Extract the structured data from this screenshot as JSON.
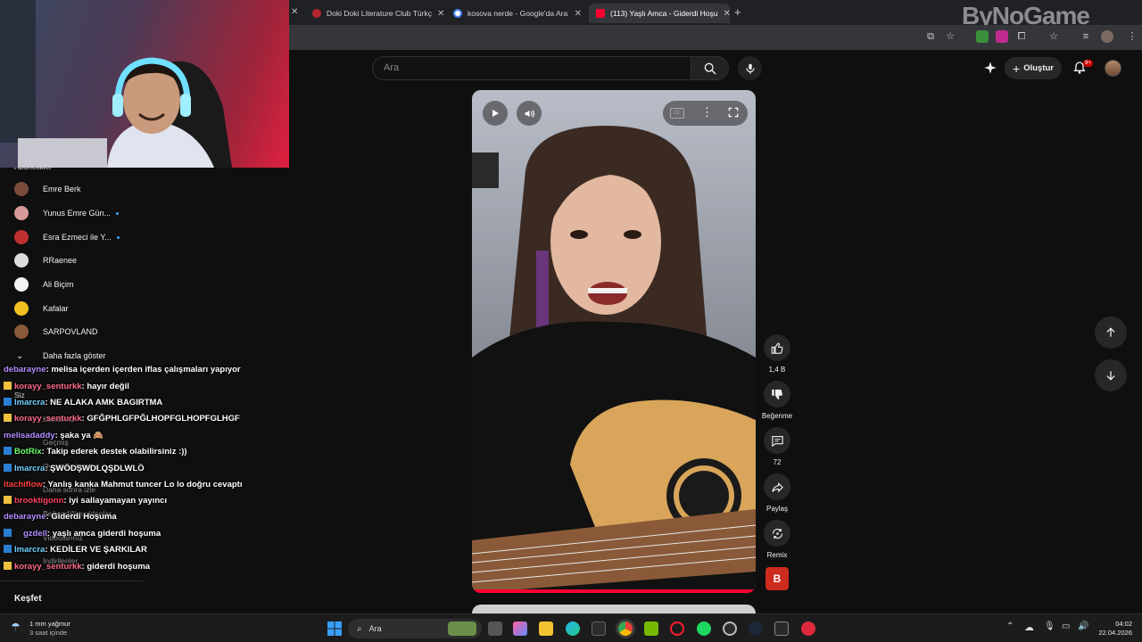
{
  "browser": {
    "tabs": [
      {
        "title": "Doki Doki Literature Club Türkç",
        "favicon_color": "#b3262e"
      },
      {
        "title": "kosova nerde - Google'da Ara",
        "favicon_color": "#ffffff"
      },
      {
        "title": "(113) Yaşlı Amca - Giderdi Hoşu",
        "favicon_color": "#ff0033"
      }
    ],
    "new_tab": "+"
  },
  "watermark": "ByNoGame",
  "youtube": {
    "search_placeholder": "Ara",
    "create_label": "Oluştur",
    "notification_count": "9+"
  },
  "sidebar": {
    "section_partial": "Abonelikler",
    "subscriptions": [
      {
        "name": "Emre Berk",
        "live": false,
        "avatar_color": "#7a4a3a"
      },
      {
        "name": "Yunus Emre Gün...",
        "live": true,
        "avatar_color": "#d79a9a"
      },
      {
        "name": "Esra Ezmeci ile Y...",
        "live": true,
        "avatar_color": "#c03030"
      },
      {
        "name": "RRaenee",
        "live": false,
        "avatar_color": "#dddddd"
      },
      {
        "name": "Ali Biçim",
        "live": false,
        "avatar_color": "#f2f2f2"
      },
      {
        "name": "Kafalar",
        "live": false,
        "avatar_color": "#f0c020"
      },
      {
        "name": "SARPOVLAND",
        "live": false,
        "avatar_color": "#8a5a3a"
      }
    ],
    "show_more": "Daha fazla göster",
    "you_section": "Siz",
    "you_items": [
      "Kanalınız",
      "Geçmiş",
      "Oynatma listeleri",
      "Daha sonra izle",
      "Beğendiğim videolar",
      "Videolarınız",
      "İndirilenler"
    ],
    "explore": "Keşfet"
  },
  "chat": [
    {
      "user": "debarayne",
      "color": "#b48cff",
      "msg": ": melisa içerden içerden iflas çalışmaları yapıyor",
      "badge": ""
    },
    {
      "user": "korayy_senturkk",
      "color": "#ff6b8a",
      "msg": ": hayır değil",
      "badge": "#f0c040"
    },
    {
      "user": "lmarcra",
      "color": "#6fd3ff",
      "msg": ": NE ALAKA AMK BAGIRTMA",
      "badge": "#2a7fd4"
    },
    {
      "user": "korayy_senturkk",
      "color": "#ff6b8a",
      "msg": ": GFĞPHLGFPĞLHOPFGLHOPFGLHGF",
      "badge": "#f0c040"
    },
    {
      "user": "melisadaddy",
      "color": "#b48cff",
      "msg": ": şaka ya 🙈",
      "badge": ""
    },
    {
      "user": "BotRix",
      "color": "#6bff6b",
      "msg": ": Takip ederek destek olabilirsiniz :))",
      "badge": "#2a7fd4"
    },
    {
      "user": "lmarcra",
      "color": "#6fd3ff",
      "msg": ": ŞWÖDŞWDLQŞDLWLÖ",
      "badge": "#2a7fd4"
    },
    {
      "user": "itachiflow",
      "color": "#ff4040",
      "msg": ": Yanlış kanka Mahmut tuncer Lo lo doğru cevaptı",
      "badge": ""
    },
    {
      "user": "brooktigonn",
      "color": "#ff4060",
      "msg": ": iyi sallayamayan yayıncı",
      "badge": "#f0c040"
    },
    {
      "user": "debarayne",
      "color": "#b48cff",
      "msg": ": Giderdi Hoşuma",
      "badge": ""
    },
    {
      "user": "gzdell",
      "color": "#b48cff",
      "msg": ": yaşlı amca giderdi hoşuma",
      "badge": "#2a7fd4"
    },
    {
      "user": "lmarcra",
      "color": "#6fd3ff",
      "msg": ": KEDİLER VE ŞARKILAR",
      "badge": "#2a7fd4"
    },
    {
      "user": "korayy_senturkk",
      "color": "#ff6b8a",
      "msg": ": giderdi hoşuma",
      "badge": "#f0c040"
    }
  ],
  "actions": {
    "likes": "1,4 B",
    "dislike": "Beğenme",
    "comments": "72",
    "share": "Paylaş",
    "remix": "Remix",
    "channel_letter": "B"
  },
  "taskbar": {
    "weather_temp": "1 mm yağmur",
    "weather_sub": "3 saat içinde",
    "search": "Ara",
    "time": "04:02",
    "date": "22.04.2026"
  }
}
